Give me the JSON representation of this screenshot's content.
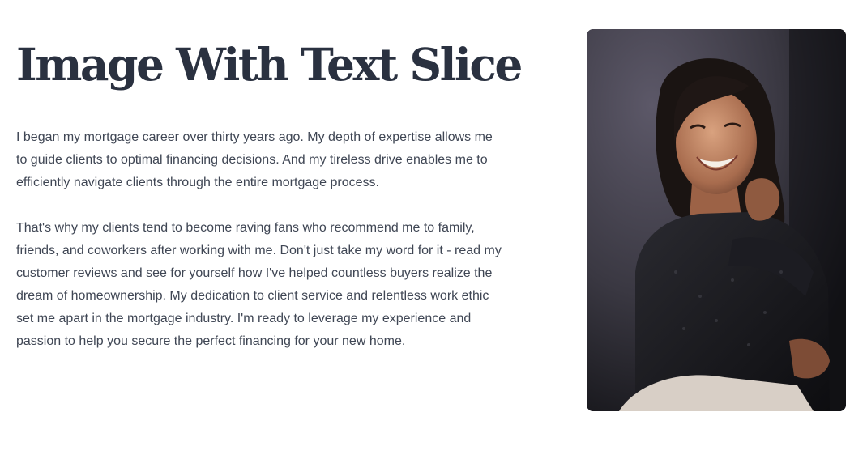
{
  "section": {
    "title": "Image With Text Slice",
    "paragraphs": [
      "I began my mortgage career over thirty years ago. My depth of expertise allows me to guide clients to optimal financing decisions. And my tireless drive enables me to efficiently navigate clients through the entire mortgage process.",
      "That's why my clients tend to become raving fans who recommend me to family, friends, and coworkers after working with me. Don't just take my word for it - read my customer reviews and see for yourself how I've helped countless buyers realize the dream of homeownership. My dedication to client service and relentless work ethic set me apart in the mortgage industry. I'm ready to leverage my experience and passion to help you secure the perfect financing for your new home."
    ]
  },
  "colors": {
    "title": "#2a3140",
    "body_text": "#3f4654",
    "background": "#ffffff"
  }
}
